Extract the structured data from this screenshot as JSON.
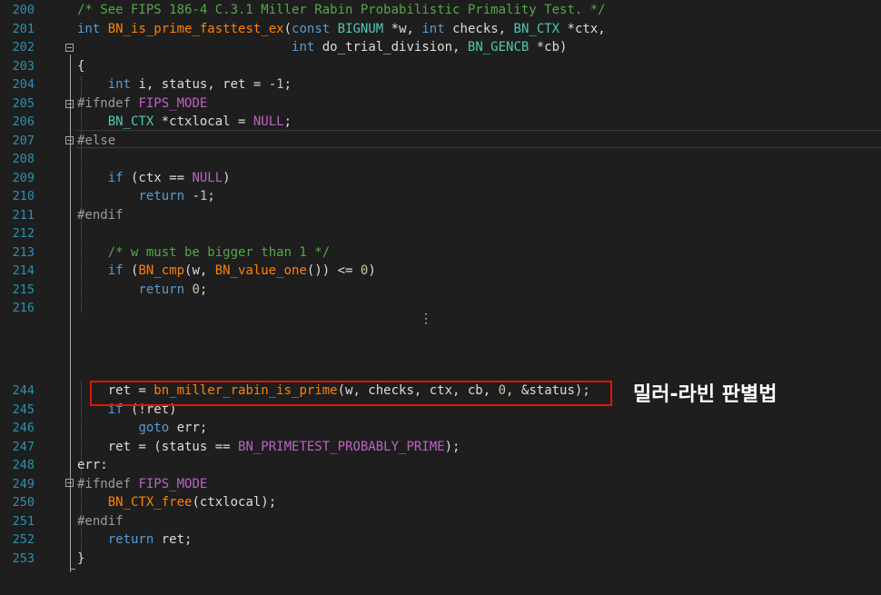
{
  "editor": {
    "lines": [
      {
        "num": "200",
        "code": "/* See FIPS 186-4 C.3.1 Miller Rabin Probabilistic Primality Test. */"
      },
      {
        "num": "201",
        "code": "int BN_is_prime_fasttest_ex(const BIGNUM *w, int checks, BN_CTX *ctx,"
      },
      {
        "num": "202",
        "code": "                            int do_trial_division, BN_GENCB *cb)"
      },
      {
        "num": "203",
        "code": "{"
      },
      {
        "num": "204",
        "code": "    int i, status, ret = -1;"
      },
      {
        "num": "205",
        "code": "#ifndef FIPS_MODE"
      },
      {
        "num": "206",
        "code": "    BN_CTX *ctxlocal = NULL;"
      },
      {
        "num": "207",
        "code": "#else"
      },
      {
        "num": "208",
        "code": ""
      },
      {
        "num": "209",
        "code": "    if (ctx == NULL)"
      },
      {
        "num": "210",
        "code": "        return -1;"
      },
      {
        "num": "211",
        "code": "#endif"
      },
      {
        "num": "212",
        "code": ""
      },
      {
        "num": "213",
        "code": "    /* w must be bigger than 1 */"
      },
      {
        "num": "214",
        "code": "    if (BN_cmp(w, BN_value_one()) <= 0)"
      },
      {
        "num": "215",
        "code": "        return 0;"
      },
      {
        "num": "216",
        "code": ""
      },
      {
        "num": "244",
        "code": "    ret = bn_miller_rabin_is_prime(w, checks, ctx, cb, 0, &status);"
      },
      {
        "num": "245",
        "code": "    if (!ret)"
      },
      {
        "num": "246",
        "code": "        goto err;"
      },
      {
        "num": "247",
        "code": "    ret = (status == BN_PRIMETEST_PROBABLY_PRIME);"
      },
      {
        "num": "248",
        "code": "err:"
      },
      {
        "num": "249",
        "code": "#ifndef FIPS_MODE"
      },
      {
        "num": "250",
        "code": "    BN_CTX_free(ctxlocal);"
      },
      {
        "num": "251",
        "code": "#endif"
      },
      {
        "num": "252",
        "code": "    return ret;"
      },
      {
        "num": "253",
        "code": "}"
      }
    ],
    "ellipsis": "⋮"
  },
  "annotation": {
    "label": "밀러-라빈 판별법",
    "highlight_color": "#e51400"
  },
  "colors": {
    "background": "#1e1e1e",
    "line_number": "#2b91af",
    "keyword": "#569cd6",
    "function": "#ff8000",
    "comment": "#57a64a",
    "macro": "#bd63c5"
  }
}
